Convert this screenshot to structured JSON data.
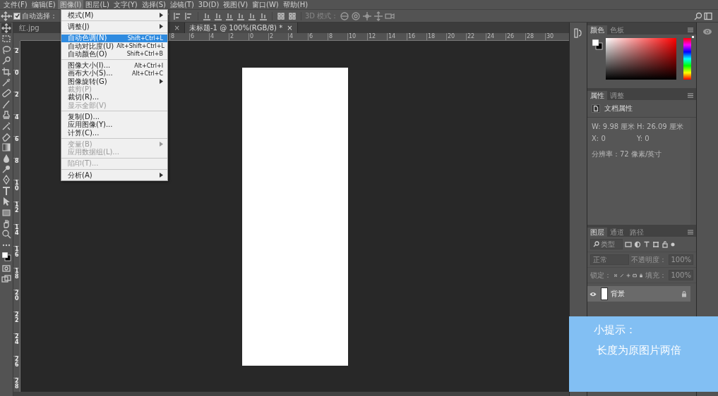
{
  "menu_bar": [
    {
      "label": "文件(F)",
      "selected": false
    },
    {
      "label": "编辑(E)",
      "selected": false
    },
    {
      "label": "图像(I)",
      "selected": true
    },
    {
      "label": "图层(L)",
      "selected": false
    },
    {
      "label": "文字(Y)",
      "selected": false
    },
    {
      "label": "选择(S)",
      "selected": false
    },
    {
      "label": "滤镜(T)",
      "selected": false
    },
    {
      "label": "3D(D)",
      "selected": false
    },
    {
      "label": "视图(V)",
      "selected": false
    },
    {
      "label": "窗口(W)",
      "selected": false
    },
    {
      "label": "帮助(H)",
      "selected": false
    }
  ],
  "options_bar": {
    "auto_select": {
      "label": "自动选择：",
      "checked": true
    },
    "mode_label": "3D 模式："
  },
  "document_tabs": [
    {
      "label": "红.jpg",
      "close": "×",
      "selected": false
    },
    {
      "label": "未标题-1 @ 100%(RGB/8) *",
      "close": "×",
      "selected": true
    }
  ],
  "horizontal_ruler": [
    "8",
    "6",
    "4",
    "2",
    "0",
    "2",
    "4",
    "6",
    "8",
    "10",
    "12",
    "14",
    "16",
    "18",
    "20",
    "22",
    "24",
    "26",
    "28",
    "30"
  ],
  "vertical_ruler": [
    "2",
    "0",
    "2",
    "4",
    "6",
    "8",
    "10",
    "12",
    "14",
    "16",
    "18",
    "20",
    "22",
    "24",
    "26",
    "28"
  ],
  "image_menu": {
    "items": [
      {
        "kind": "item",
        "label": "模式(M)",
        "submenu": true,
        "disabled": false,
        "selected": false
      },
      {
        "kind": "separator"
      },
      {
        "kind": "item",
        "label": "调整(J)",
        "submenu": true,
        "disabled": false,
        "selected": false
      },
      {
        "kind": "separator"
      },
      {
        "kind": "item",
        "label": "自动色调(N)",
        "shortcut": "Shift+Ctrl+L",
        "submenu": false,
        "disabled": false,
        "selected": true
      },
      {
        "kind": "item",
        "label": "自动对比度(U)",
        "shortcut": "Alt+Shift+Ctrl+L",
        "submenu": false,
        "disabled": false,
        "selected": false
      },
      {
        "kind": "item",
        "label": "自动颜色(O)",
        "shortcut": "Shift+Ctrl+B",
        "submenu": false,
        "disabled": false,
        "selected": false
      },
      {
        "kind": "separator"
      },
      {
        "kind": "item",
        "label": "图像大小(I)...",
        "shortcut": "Alt+Ctrl+I",
        "submenu": false,
        "disabled": false,
        "selected": false
      },
      {
        "kind": "item",
        "label": "画布大小(S)...",
        "shortcut": "Alt+Ctrl+C",
        "submenu": false,
        "disabled": false,
        "selected": false
      },
      {
        "kind": "item",
        "label": "图像旋转(G)",
        "submenu": true,
        "disabled": false,
        "selected": false
      },
      {
        "kind": "item",
        "label": "裁剪(P)",
        "submenu": false,
        "disabled": true,
        "selected": false
      },
      {
        "kind": "item",
        "label": "裁切(R)...",
        "submenu": false,
        "disabled": false,
        "selected": false
      },
      {
        "kind": "item",
        "label": "显示全部(V)",
        "submenu": false,
        "disabled": true,
        "selected": false
      },
      {
        "kind": "separator"
      },
      {
        "kind": "item",
        "label": "复制(D)...",
        "submenu": false,
        "disabled": false,
        "selected": false
      },
      {
        "kind": "item",
        "label": "应用图像(Y)...",
        "submenu": false,
        "disabled": false,
        "selected": false
      },
      {
        "kind": "item",
        "label": "计算(C)...",
        "submenu": false,
        "disabled": false,
        "selected": false
      },
      {
        "kind": "separator"
      },
      {
        "kind": "item",
        "label": "变量(B)",
        "submenu": true,
        "disabled": true,
        "selected": false
      },
      {
        "kind": "item",
        "label": "应用数据组(L)...",
        "submenu": false,
        "disabled": true,
        "selected": false
      },
      {
        "kind": "separator"
      },
      {
        "kind": "item",
        "label": "陷印(T)...",
        "submenu": false,
        "disabled": true,
        "selected": false
      },
      {
        "kind": "separator"
      },
      {
        "kind": "item",
        "label": "分析(A)",
        "submenu": true,
        "disabled": false,
        "selected": false
      }
    ]
  },
  "color_panel": {
    "tabs": [
      {
        "label": "颜色",
        "selected": true
      },
      {
        "label": "色板",
        "selected": false
      }
    ],
    "hue_slider": {
      "level": 1
    }
  },
  "properties_panel": {
    "tabs": [
      {
        "label": "属性",
        "selected": true
      },
      {
        "label": "调整",
        "selected": false
      }
    ],
    "title": "文档属性",
    "fields": [
      {
        "label": "W:",
        "value": "9.98 厘米"
      },
      {
        "label": "H:",
        "value": "26.09 厘米"
      },
      {
        "label": "X:",
        "value": "0"
      },
      {
        "label": "Y:",
        "value": "0"
      }
    ],
    "resolution": "分辨率：72 像素/英寸"
  },
  "layers_panel": {
    "tabs": [
      {
        "label": "图层",
        "selected": true
      },
      {
        "label": "通道",
        "selected": false
      },
      {
        "label": "路径",
        "selected": false
      }
    ],
    "filter_placeholder": "类型",
    "blend_mode": "正常",
    "opacity_label": "不透明度：",
    "opacity": "100%",
    "lock_label": "锁定：",
    "fill_label": "填充：",
    "fill": "100%",
    "layers": [
      {
        "name": "背景",
        "visible": true,
        "locked": true,
        "selected": true
      }
    ]
  },
  "tip": {
    "title": "小提示：",
    "text": "长度为原图片两倍"
  }
}
